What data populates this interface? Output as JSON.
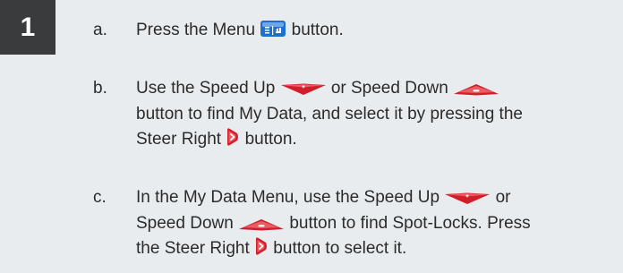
{
  "step": {
    "number": "1"
  },
  "items": [
    {
      "letter": "a.",
      "lines": [
        {
          "before": "Press the Menu ",
          "icon": "menu-button-icon",
          "after": " button."
        }
      ]
    },
    {
      "letter": "b.",
      "lines": [
        {
          "before": "Use the Speed Up ",
          "icon1": "speed-up-button-icon",
          "middle": " or Speed Down ",
          "icon2": "speed-down-button-icon",
          "after": ""
        },
        {
          "text": "button to find My Data, and select it by pressing the"
        },
        {
          "before": "Steer Right ",
          "icon": "steer-right-button-icon",
          "after": " button."
        }
      ]
    },
    {
      "letter": "c.",
      "lines": [
        {
          "before": "In the My Data Menu, use the Speed Up ",
          "icon": "speed-up-button-icon",
          "after": " or"
        },
        {
          "before": "Speed Down ",
          "icon": "speed-down-button-icon",
          "after": " button to find Spot-Locks. Press"
        },
        {
          "before": "the Steer Right ",
          "icon": "steer-right-button-icon",
          "after": " button to select it."
        }
      ]
    }
  ],
  "colors": {
    "background": "#e9ecee",
    "badge": "#3a3b3d",
    "icon_red": "#d01f2a",
    "menu_icon_blue": "#1f6fd1"
  }
}
